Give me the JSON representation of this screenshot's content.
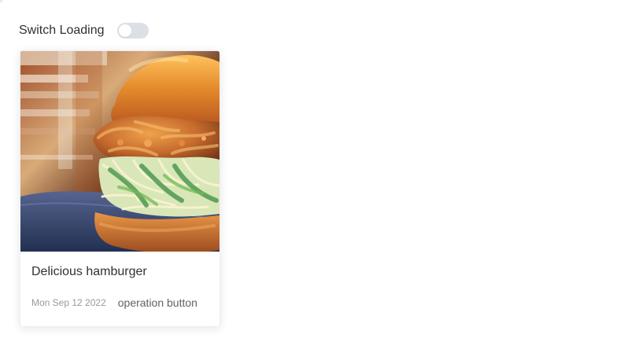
{
  "toolbar": {
    "label": "Switch Loading",
    "loading_switch_on": false
  },
  "card": {
    "image_icon": "hamburger-photo",
    "title": "Delicious hamburger",
    "time": "Mon Sep 12 2022",
    "button_label": "operation button"
  },
  "colors": {
    "switch_off": "#dcdfe6",
    "title_text": "#303133",
    "time_text": "#999999",
    "button_text": "#606266"
  }
}
